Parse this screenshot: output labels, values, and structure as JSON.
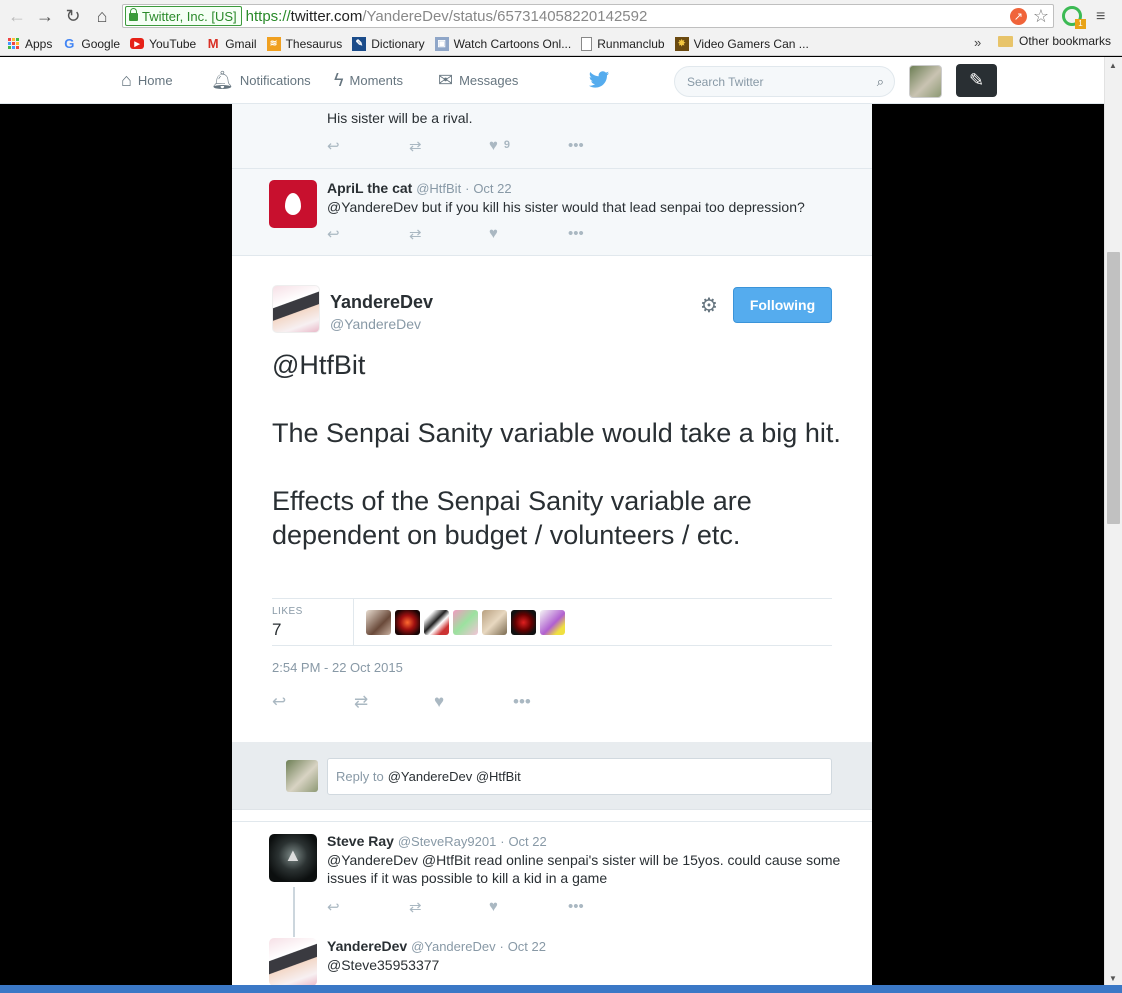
{
  "browser": {
    "ev_label": "Twitter, Inc. [US]",
    "url_scheme": "https://",
    "url_host": "twitter.com",
    "url_path": "/YandereDev/status/657314058220142592",
    "bookmarks": [
      {
        "label": "Apps",
        "icon": "apps-grid-icon"
      },
      {
        "label": "Google",
        "icon": "google-icon"
      },
      {
        "label": "YouTube",
        "icon": "youtube-icon"
      },
      {
        "label": "Gmail",
        "icon": "gmail-icon"
      },
      {
        "label": "Thesaurus",
        "icon": "thesaurus-icon"
      },
      {
        "label": "Dictionary",
        "icon": "dictionary-icon"
      },
      {
        "label": "Watch Cartoons Onl...",
        "icon": "cartoons-icon"
      },
      {
        "label": "Runmanclub",
        "icon": "page-icon"
      },
      {
        "label": "Video Gamers Can ...",
        "icon": "gamers-icon"
      }
    ],
    "bookmarks_more": "»",
    "other_bookmarks": "Other bookmarks"
  },
  "twitter_nav": {
    "home": "Home",
    "notifications": "Notifications",
    "moments": "Moments",
    "messages": "Messages",
    "search_placeholder": "Search Twitter"
  },
  "ancestors": [
    {
      "text": "His sister will be a rival.",
      "like_count": "9"
    },
    {
      "name": "ApriL the cat",
      "handle": "@HtfBit",
      "date": "Oct 22",
      "text": "@YandereDev but if you kill his sister would that lead senpai too depression?"
    }
  ],
  "main_tweet": {
    "name": "YandereDev",
    "handle": "@YandereDev",
    "follow_label": "Following",
    "text": "@HtfBit\n\nThe Senpai Sanity variable would take a big hit.\n\nEffects of the Senpai Sanity variable are dependent on budget / volunteers / etc.",
    "likes_label": "LIKES",
    "likes_count": "7",
    "timestamp": "2:54 PM - 22 Oct 2015"
  },
  "reply_box": {
    "placeholder": "Reply to",
    "mentions": "@YandereDev @HtfBit"
  },
  "replies": [
    {
      "name": "Steve Ray",
      "handle": "@SteveRay9201",
      "date": "Oct 22",
      "text": "@YandereDev @HtfBit read online senpai's sister will be 15yos. could cause some issues if it was possible to kill a kid in a game"
    },
    {
      "name": "YandereDev",
      "handle": "@YandereDev",
      "date": "Oct 22",
      "text": "@Steve35953377"
    }
  ],
  "colors": {
    "twitter_blue": "#55acee",
    "action_gray": "#aab8c2",
    "text_dark": "#292f33",
    "meta_gray": "#8899a6"
  }
}
